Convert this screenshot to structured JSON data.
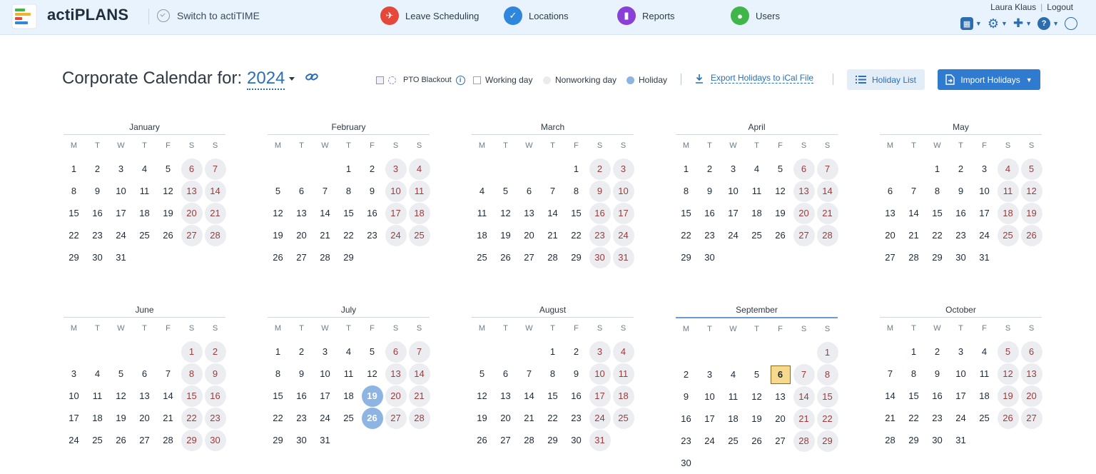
{
  "header": {
    "brand": "actiPLANS",
    "switch_label": "Switch to actiTIME",
    "nav": [
      {
        "label": "Leave Scheduling",
        "icon": "leave-scheduling-icon",
        "color": "#e5483b"
      },
      {
        "label": "Locations",
        "icon": "locations-icon",
        "color": "#2f86dd"
      },
      {
        "label": "Reports",
        "icon": "reports-icon",
        "color": "#8a3fd6"
      },
      {
        "label": "Users",
        "icon": "users-icon",
        "color": "#3fb54a"
      }
    ],
    "user_name": "Laura Klaus",
    "logout_label": "Logout"
  },
  "page": {
    "title": "Corporate Calendar for:",
    "year": "2024",
    "legend": {
      "pto_blackout": "PTO Blackout",
      "working_day": "Working day",
      "nonworking_day": "Nonworking day",
      "holiday": "Holiday"
    },
    "export_label": "Export Holidays to iCal File",
    "holiday_list_label": "Holiday List",
    "import_label": "Import Holidays"
  },
  "weekday_headers": [
    "M",
    "T",
    "W",
    "T",
    "F",
    "S",
    "S"
  ],
  "months": [
    {
      "name": "January",
      "offset": 0,
      "days": 31,
      "holidays": [],
      "today": null
    },
    {
      "name": "February",
      "offset": 3,
      "days": 29,
      "holidays": [],
      "today": null
    },
    {
      "name": "March",
      "offset": 4,
      "days": 31,
      "holidays": [],
      "today": null
    },
    {
      "name": "April",
      "offset": 0,
      "days": 30,
      "holidays": [],
      "today": null
    },
    {
      "name": "May",
      "offset": 2,
      "days": 31,
      "holidays": [],
      "today": null
    },
    {
      "name": "June",
      "offset": 5,
      "days": 30,
      "holidays": [],
      "today": null
    },
    {
      "name": "July",
      "offset": 0,
      "days": 31,
      "holidays": [
        19,
        26
      ],
      "today": null
    },
    {
      "name": "August",
      "offset": 3,
      "days": 31,
      "holidays": [],
      "today": null
    },
    {
      "name": "September",
      "offset": 6,
      "days": 30,
      "holidays": [],
      "today": 6
    },
    {
      "name": "October",
      "offset": 1,
      "days": 31,
      "holidays": [],
      "today": null
    }
  ]
}
